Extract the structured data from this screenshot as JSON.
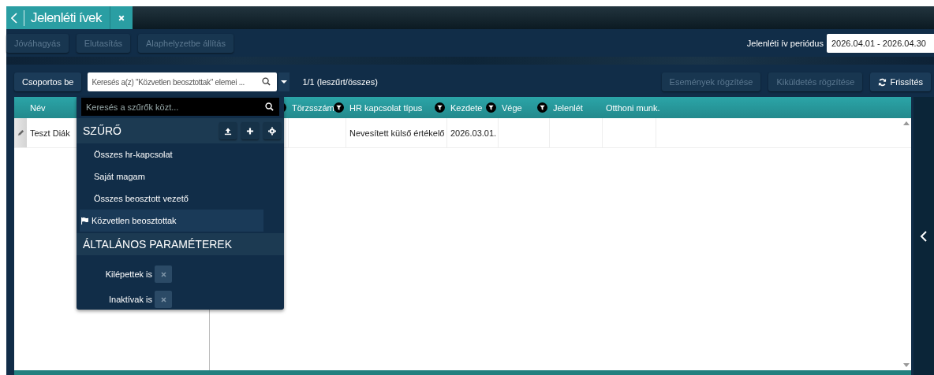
{
  "tab_bar": {
    "tabs": [
      {
        "title": "Jelenléti ívek",
        "selected": true
      }
    ]
  },
  "toolbar": {
    "buttons": [
      {
        "label": "Jóváhagyás",
        "disabled": true
      },
      {
        "label": "Elutasítás",
        "disabled": true
      },
      {
        "label": "Alaphelyzetbe állítás",
        "disabled": true
      }
    ],
    "period": {
      "label": "Jelenléti ív periódus",
      "value": "2026.04.01 - 2026.04.30"
    }
  },
  "list_toolbar": {
    "group_button": "Csoportos be",
    "search": {
      "placeholder": "Keresés a(z) \"Közvetlen beosztottak\" elemei ..."
    },
    "count": "1/1 (leszűrt/összes)",
    "buttons": [
      {
        "label": "Események rögzítése",
        "disabled": true
      },
      {
        "label": "Kiküldetés rögzítése",
        "disabled": true
      },
      {
        "label": "Frissítés",
        "disabled": false
      }
    ]
  },
  "table": {
    "frozen_column": {
      "label": "Név"
    },
    "columns": [
      {
        "filter": true
      },
      {
        "label": "Törzsszám",
        "filter": true
      },
      {
        "label": "HR kapcsolat típus",
        "filter": true
      },
      {
        "label": "Kezdete",
        "filter": true
      },
      {
        "label": "Vége",
        "filter": true
      },
      {
        "label": "Jelenlét",
        "filter": false
      },
      {
        "label": "Otthoni munk.",
        "filter": false
      }
    ],
    "rows": [
      {
        "name": "Teszt Diák",
        "cells": [
          null,
          null,
          "Nevesített külső értékelő",
          "2026.03.01.",
          null,
          null,
          null
        ]
      }
    ]
  },
  "filter_panel": {
    "search": {
      "placeholder": "Keresés a szűrők közt..."
    },
    "filter_section": {
      "title": "SZŰRŐ",
      "items": [
        {
          "label": "Összes hr-kapcsolat",
          "selected": false
        },
        {
          "label": "Saját magam",
          "selected": false
        },
        {
          "label": "Összes beosztott vezető",
          "selected": false
        },
        {
          "label": "Közvetlen beosztottak",
          "selected": true
        }
      ]
    },
    "params_section": {
      "title": "ÁLTALÁNOS PARAMÉTEREK",
      "toggles": [
        {
          "label": "Kilépettek is",
          "on": false
        },
        {
          "label": "Inaktívak is",
          "on": false
        }
      ]
    }
  }
}
